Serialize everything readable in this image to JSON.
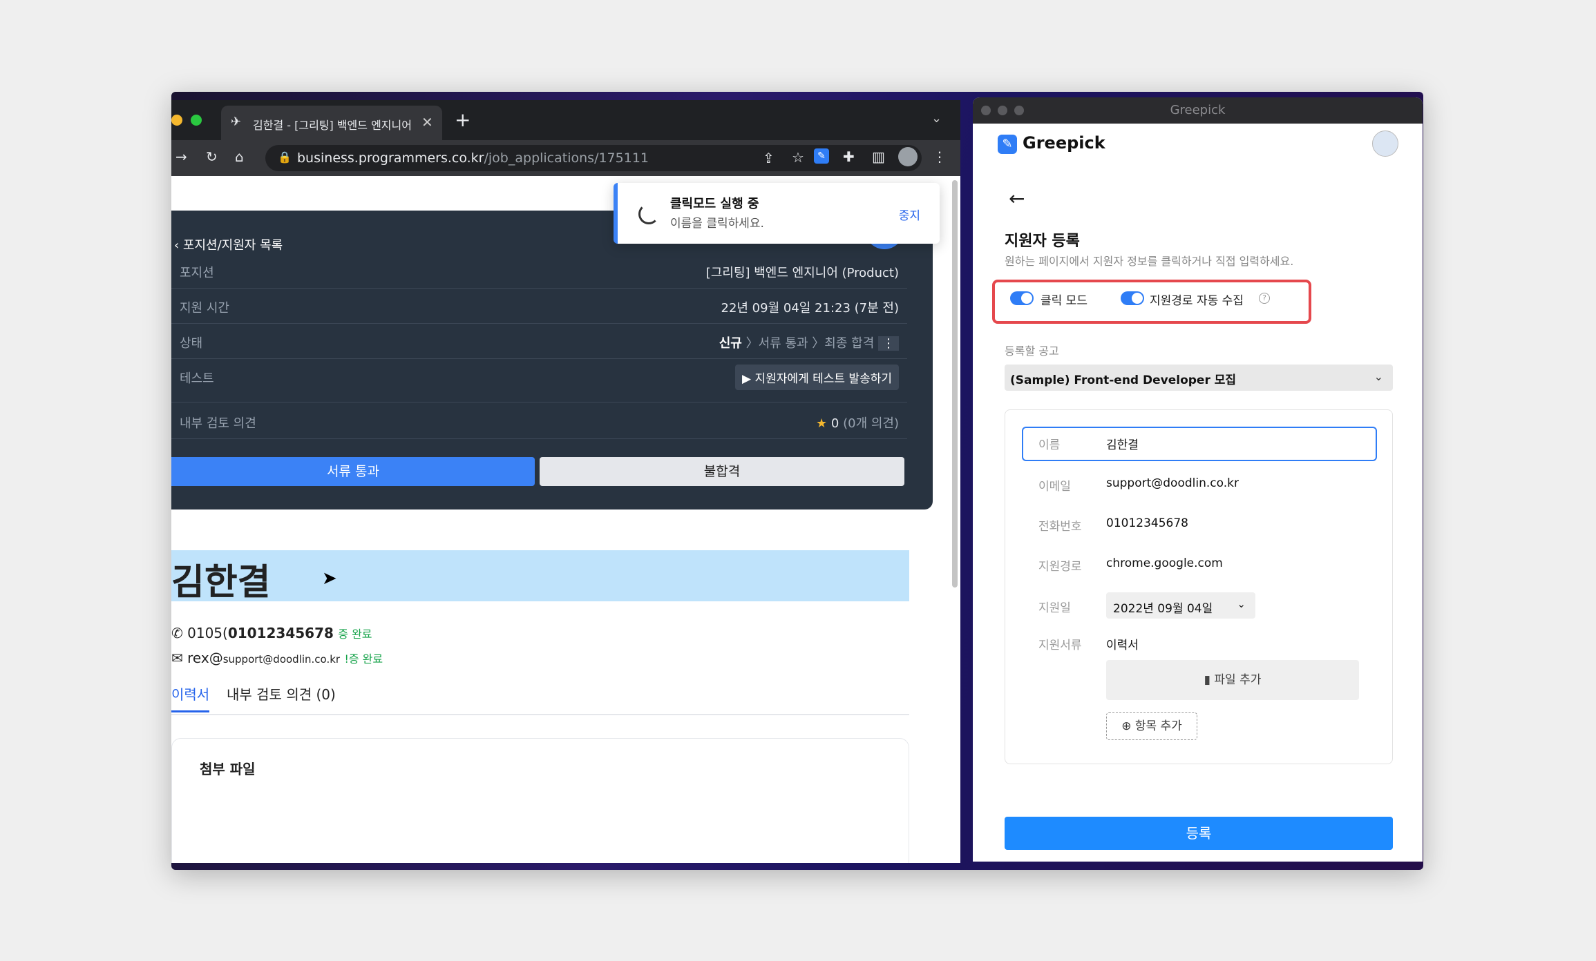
{
  "browser": {
    "tab_title": "김한결 - [그리팅] 백엔드 엔지니어 (P",
    "url_host": "business.programmers.co.kr",
    "url_path": "/job_applications/175111"
  },
  "toast": {
    "title": "클릭모드 실행 중",
    "subtitle": "이름을 클릭하세요.",
    "stop_label": "중지"
  },
  "applicant_card": {
    "back_label": "포지션/지원자 목록",
    "rows": [
      {
        "key": "포지션",
        "value": "[그리팅] 백엔드 엔지니어 (Product)"
      },
      {
        "key": "지원 시간",
        "value": "22년 09월 04일 21:23 (7분 전)"
      },
      {
        "key": "상태",
        "value": "〉서류 통과 〉최종 합격",
        "value_bold": "신규"
      },
      {
        "key": "테스트",
        "value": "▶ 지원자에게 테스트 발송하기"
      },
      {
        "key": "내부 검토 의견",
        "value": "0",
        "value_extra": "(0개 의견)"
      }
    ],
    "pass_label": "서류 통과",
    "fail_label": "불합격"
  },
  "profile": {
    "name": "김한결",
    "phone_prefix": "0105(",
    "phone": "01012345678",
    "phone_status": "증 완료",
    "email_prefix": "rex@",
    "email": "support@doodlin.co.kr",
    "email_status": "!증 완료",
    "tabs": [
      "이력서",
      "내부 검토 의견 (0)"
    ],
    "attach_title": "첨부 파일"
  },
  "greepick": {
    "window_title": "Greepick",
    "logo": "Greepick",
    "heading": "지원자 등록",
    "subheading": "원하는 페이지에서 지원자 정보를 클릭하거나 직접 입력하세요.",
    "toggles": [
      {
        "label": "클릭 모드",
        "on": true
      },
      {
        "label": "지원경로 자동 수집",
        "on": true
      }
    ],
    "job_label": "등록할 공고",
    "job_value": "(Sample) Front-end Developer 모집",
    "fields": [
      {
        "key": "이름",
        "value": "김한결"
      },
      {
        "key": "이메일",
        "value": "support@doodlin.co.kr"
      },
      {
        "key": "전화번호",
        "value": "01012345678"
      },
      {
        "key": "지원경로",
        "value": "chrome.google.com"
      },
      {
        "key": "지원일",
        "value": "2022년 09월 04일"
      },
      {
        "key": "지원서류",
        "value": "이력서"
      }
    ],
    "file_button": "파일 추가",
    "add_item_button": "항목 추가",
    "submit_label": "등록"
  },
  "colors": {
    "accent": "#2f7df6",
    "highlight": "#e5484d",
    "dark_card": "#283340",
    "name_highlight": "#bfe3fb"
  }
}
